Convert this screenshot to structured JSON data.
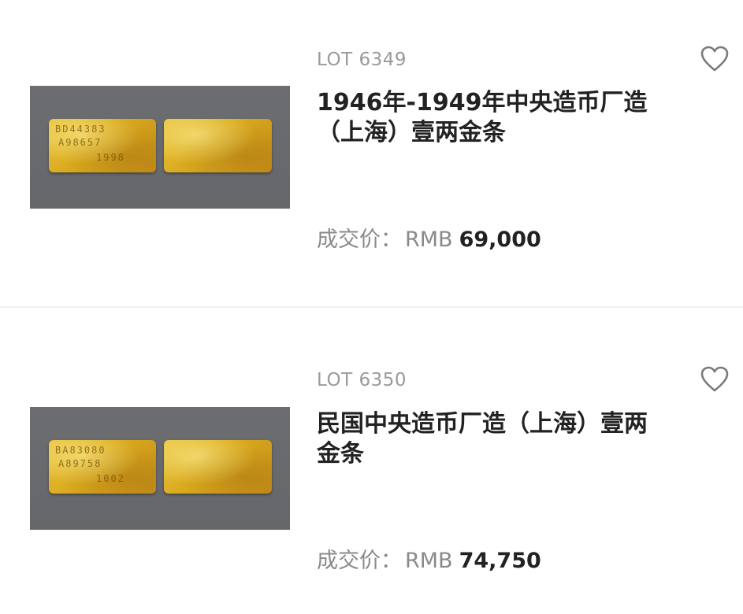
{
  "lots": [
    {
      "lot_number": "LOT 6349",
      "title_line1": "1946年-1949年中央造币厂造",
      "title_line2": "（上海）壹两金条",
      "price_label": "成交价：",
      "currency": "RMB",
      "price": "69,000",
      "image": {
        "description_icon": "gold-bar-image",
        "stamp_line1": "BD44383",
        "stamp_line2": "A98657",
        "stamp_line3": "1998"
      }
    },
    {
      "lot_number": "LOT 6350",
      "title_line1": "民国中央造币厂造（上海）壹两",
      "title_line2": "金条",
      "price_label": "成交价：",
      "currency": "RMB",
      "price": "74,750",
      "image": {
        "description_icon": "gold-bar-image",
        "stamp_line1": "BA83080",
        "stamp_line2": "A89758",
        "stamp_line3": "1002"
      }
    }
  ],
  "colors": {
    "lot_number": "#9a9a9a",
    "title": "#222222",
    "price_label": "#8a8a8a",
    "divider": "#f1f1f1",
    "gold": "#d9a91d",
    "thumb_bg": "#6c6d70"
  },
  "icons": {
    "favorite": "heart-outline-icon"
  }
}
